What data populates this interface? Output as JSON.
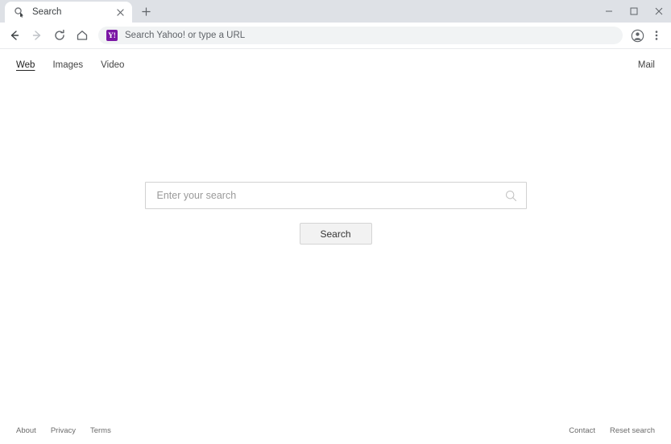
{
  "browser": {
    "tab": {
      "title": "Search",
      "favicon_icon": "magnifier-cursor-icon",
      "close_icon": "close-icon"
    },
    "new_tab_icon": "plus-icon",
    "window_controls": {
      "minimize_icon": "minimize-icon",
      "maximize_icon": "maximize-icon",
      "close_icon": "close-icon"
    },
    "toolbar": {
      "back_icon": "back-arrow-icon",
      "forward_icon": "forward-arrow-icon",
      "reload_icon": "reload-icon",
      "home_icon": "home-icon",
      "omnibox": {
        "site_icon": "yahoo-y-icon",
        "site_icon_color": "#7b16a5",
        "site_icon_glyph": "Y!",
        "placeholder": "Search Yahoo! or type a URL",
        "value": ""
      },
      "profile_icon": "profile-avatar-icon",
      "menu_icon": "three-dot-menu-icon"
    }
  },
  "page": {
    "nav": {
      "links": [
        {
          "label": "Web",
          "active": true
        },
        {
          "label": "Images",
          "active": false
        },
        {
          "label": "Video",
          "active": false
        }
      ],
      "mail_label": "Mail"
    },
    "search": {
      "placeholder": "Enter your search",
      "value": "",
      "icon": "search-magnifier-icon",
      "button_label": "Search"
    },
    "footer": {
      "left_links": [
        "About",
        "Privacy",
        "Terms"
      ],
      "right_links": [
        "Contact",
        "Reset search"
      ]
    }
  }
}
